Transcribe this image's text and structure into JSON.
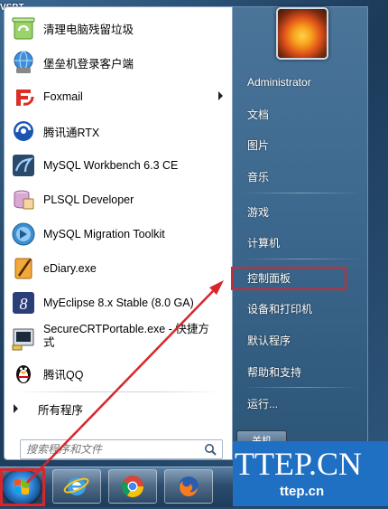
{
  "watermark_corner": "VSBT",
  "programs": [
    {
      "label": "清理电脑残留垃圾",
      "icon": "recycle-icon",
      "has_submenu": false
    },
    {
      "label": "堡垒机登录客户端",
      "icon": "globe-client-icon",
      "has_submenu": false
    },
    {
      "label": "Foxmail",
      "icon": "foxmail-icon",
      "has_submenu": true
    },
    {
      "label": "腾讯通RTX",
      "icon": "rtx-icon",
      "has_submenu": false
    },
    {
      "label": "MySQL Workbench 6.3 CE",
      "icon": "mysql-workbench-icon",
      "has_submenu": false
    },
    {
      "label": "PLSQL Developer",
      "icon": "plsql-icon",
      "has_submenu": false
    },
    {
      "label": "MySQL Migration Toolkit",
      "icon": "migration-toolkit-icon",
      "has_submenu": false
    },
    {
      "label": "eDiary.exe",
      "icon": "ediary-icon",
      "has_submenu": false
    },
    {
      "label": "MyEclipse 8.x Stable (8.0 GA)",
      "icon": "myeclipse-icon",
      "has_submenu": false
    },
    {
      "label": "SecureCRTPortable.exe - 快捷方式",
      "icon": "securecrt-icon",
      "has_submenu": false
    },
    {
      "label": "腾讯QQ",
      "icon": "qq-penguin-icon",
      "has_submenu": false
    }
  ],
  "all_programs": "所有程序",
  "search_placeholder": "搜索程序和文件",
  "right_menu": {
    "user": "Administrator",
    "documents": "文档",
    "pictures": "图片",
    "music": "音乐",
    "games": "游戏",
    "computer": "计算机",
    "control_panel": "控制面板",
    "devices_printers": "设备和打印机",
    "default_programs": "默认程序",
    "help_support": "帮助和支持",
    "run": "运行...",
    "shutdown": "关机"
  },
  "watermark": {
    "big": "TTEP.CN",
    "small": "ttep.cn"
  },
  "colors": {
    "highlight": "#d8262b",
    "watermark_bg": "#1f6fc2"
  }
}
